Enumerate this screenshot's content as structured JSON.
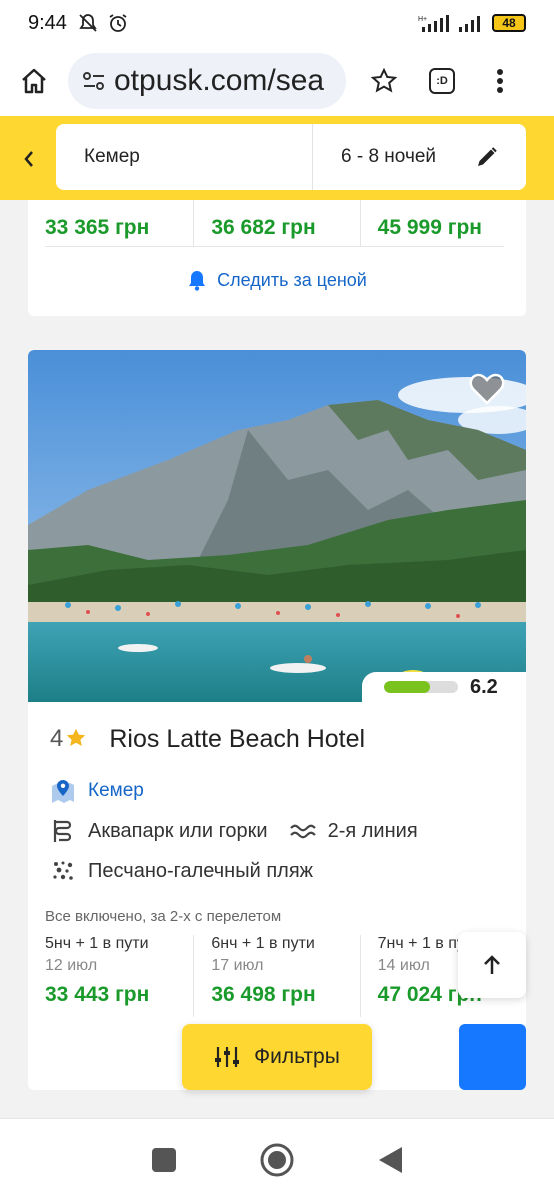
{
  "status_bar": {
    "time": "9:44",
    "battery": "48"
  },
  "browser": {
    "url": "otpusk.com/sea"
  },
  "search": {
    "destination": "Кемер",
    "nights": "6 - 8 ночей"
  },
  "prev_card": {
    "prices": [
      "33 365 грн",
      "36 682 грн",
      "45 999 грн"
    ],
    "track_label": "Следить за ценой"
  },
  "hotel": {
    "stars": "4",
    "name": "Rios Latte Beach Hotel",
    "rating": "6.2",
    "rating_fraction": 0.62,
    "location": "Кемер",
    "features": [
      "Аквапарк или горки",
      "2-я линия",
      "Песчано-галечный пляж"
    ],
    "offer_label": "Все включено, за 2-х с перелетом",
    "offers": [
      {
        "nights": "5нч + 1 в пути",
        "date": "12 июл",
        "price": "33 443 грн"
      },
      {
        "nights": "6нч + 1 в пути",
        "date": "17 июл",
        "price": "36 498 грн"
      },
      {
        "nights": "7нч + 1 в пути",
        "date": "14 июл",
        "price": "47 024 грн"
      }
    ]
  },
  "filters_label": "Фильтры",
  "colors": {
    "brand_yellow": "#fed731",
    "price_green": "#1a9a2a",
    "link_blue": "#1666c8",
    "button_blue": "#1677ff"
  }
}
